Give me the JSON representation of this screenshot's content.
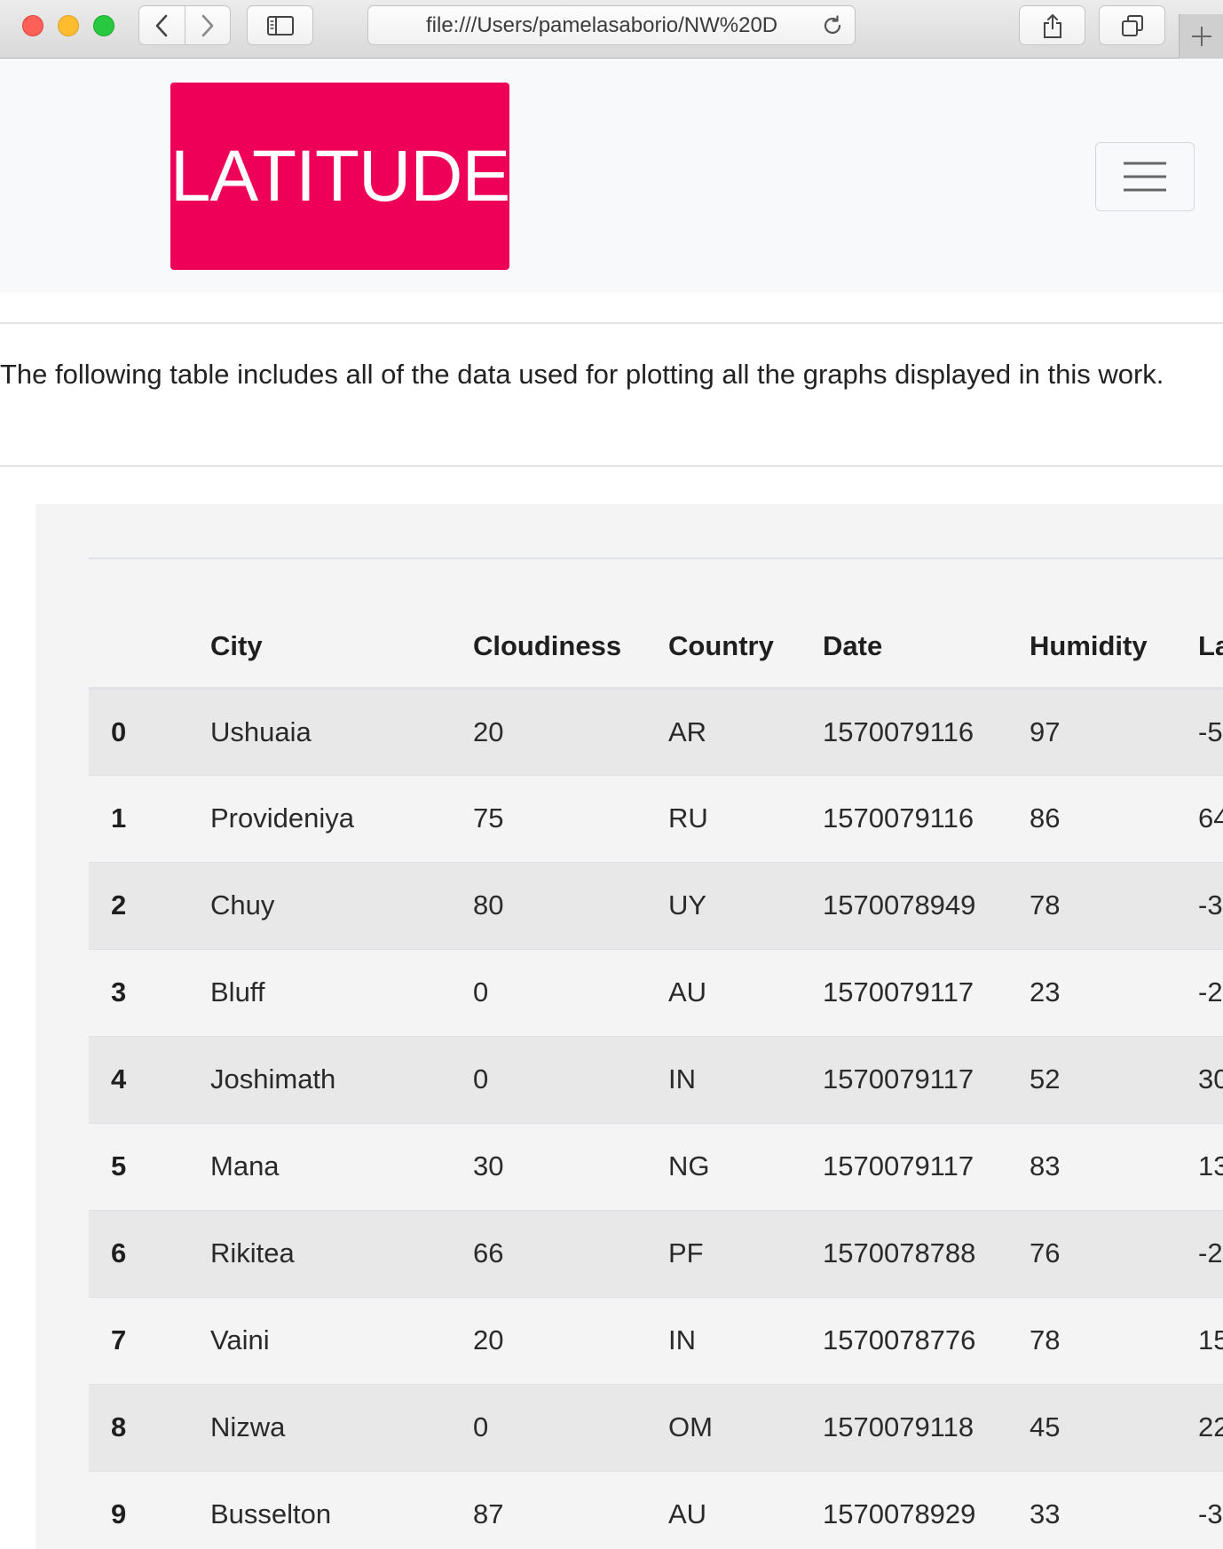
{
  "browser": {
    "url": "file:///Users/pamelasaborio/NW%20D"
  },
  "navbar": {
    "brand": "LATITUDE",
    "brand_color": "#ee0059"
  },
  "intro": {
    "text": "The following table includes all of the data used for plotting all the graphs displayed in this work."
  },
  "table": {
    "columns": [
      "",
      "City",
      "Cloudiness",
      "Country",
      "Date",
      "Humidity",
      "La"
    ],
    "rows": [
      {
        "index": "0",
        "city": "Ushuaia",
        "cloudiness": "20",
        "country": "AR",
        "date": "1570079116",
        "humidity": "97",
        "lat": "-5"
      },
      {
        "index": "1",
        "city": "Provideniya",
        "cloudiness": "75",
        "country": "RU",
        "date": "1570079116",
        "humidity": "86",
        "lat": "64"
      },
      {
        "index": "2",
        "city": "Chuy",
        "cloudiness": "80",
        "country": "UY",
        "date": "1570078949",
        "humidity": "78",
        "lat": "-3"
      },
      {
        "index": "3",
        "city": "Bluff",
        "cloudiness": "0",
        "country": "AU",
        "date": "1570079117",
        "humidity": "23",
        "lat": "-2"
      },
      {
        "index": "4",
        "city": "Joshimath",
        "cloudiness": "0",
        "country": "IN",
        "date": "1570079117",
        "humidity": "52",
        "lat": "30"
      },
      {
        "index": "5",
        "city": "Mana",
        "cloudiness": "30",
        "country": "NG",
        "date": "1570079117",
        "humidity": "83",
        "lat": "13"
      },
      {
        "index": "6",
        "city": "Rikitea",
        "cloudiness": "66",
        "country": "PF",
        "date": "1570078788",
        "humidity": "76",
        "lat": "-2"
      },
      {
        "index": "7",
        "city": "Vaini",
        "cloudiness": "20",
        "country": "IN",
        "date": "1570078776",
        "humidity": "78",
        "lat": "15"
      },
      {
        "index": "8",
        "city": "Nizwa",
        "cloudiness": "0",
        "country": "OM",
        "date": "1570079118",
        "humidity": "45",
        "lat": "22"
      },
      {
        "index": "9",
        "city": "Busselton",
        "cloudiness": "87",
        "country": "AU",
        "date": "1570078929",
        "humidity": "33",
        "lat": "-3"
      }
    ]
  }
}
